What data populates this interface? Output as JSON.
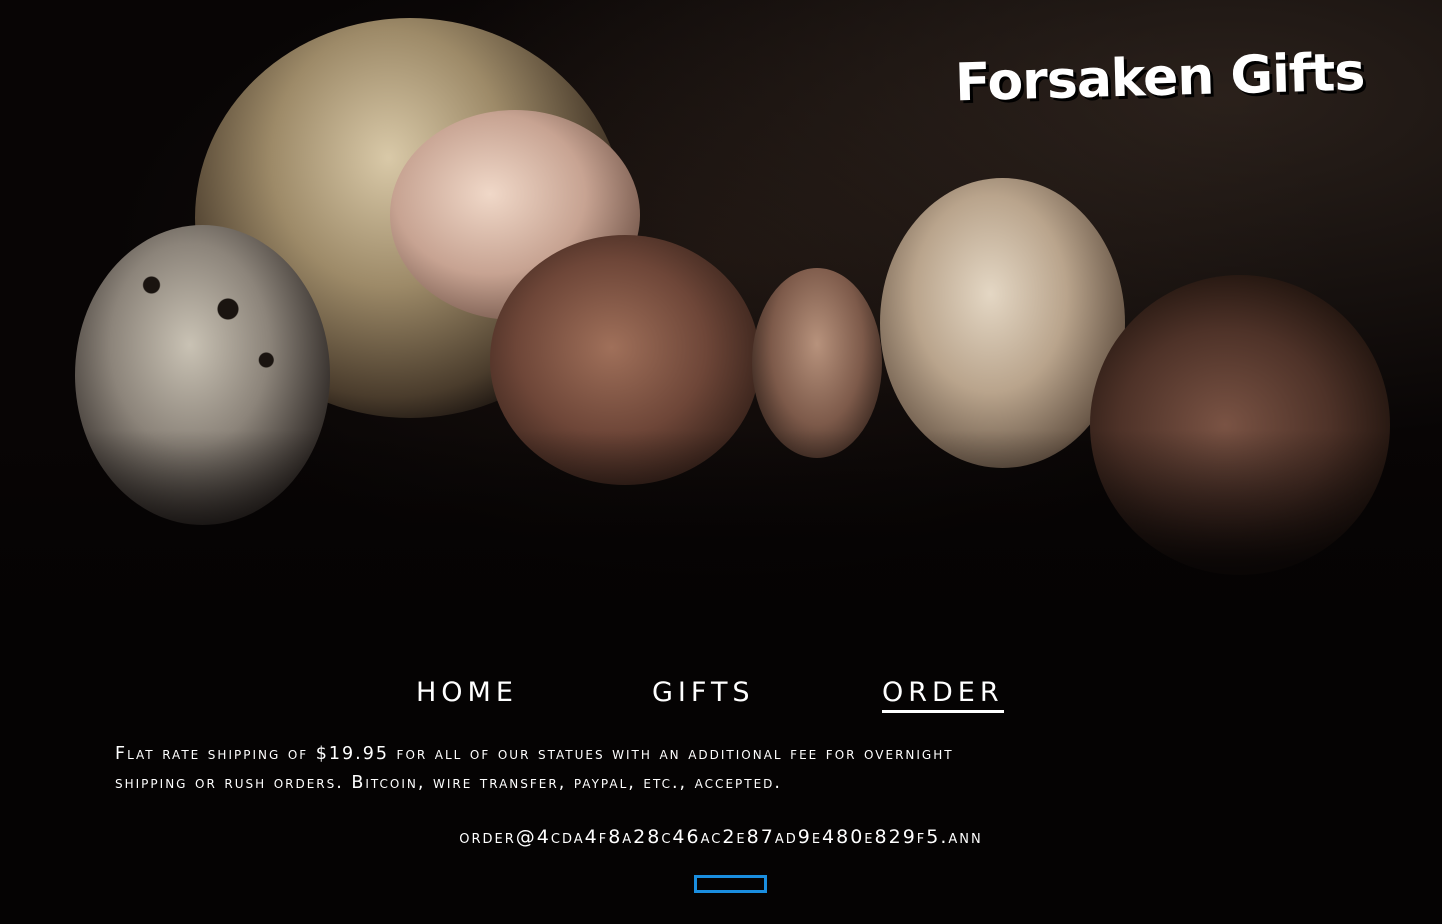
{
  "site": {
    "logo_text": "Forsaken Gifts"
  },
  "nav": {
    "items": [
      {
        "label": "HOME"
      },
      {
        "label": "GIFTS"
      },
      {
        "label": "ORDER"
      }
    ],
    "active": "ORDER"
  },
  "content": {
    "shipping_line1": "Flat rate shipping of $19.95 for all of our statues with an additional fee for overnight",
    "shipping_line2": "shipping or rush orders. Bitcoin, wire transfer, paypal, etc., accepted.",
    "email": "order@4cda4f8a28c46ac2e87ad9e480e829f5.ann"
  },
  "colors": {
    "background": "#050303",
    "text": "#ffffff",
    "accent_box": "#1a8ee0"
  }
}
